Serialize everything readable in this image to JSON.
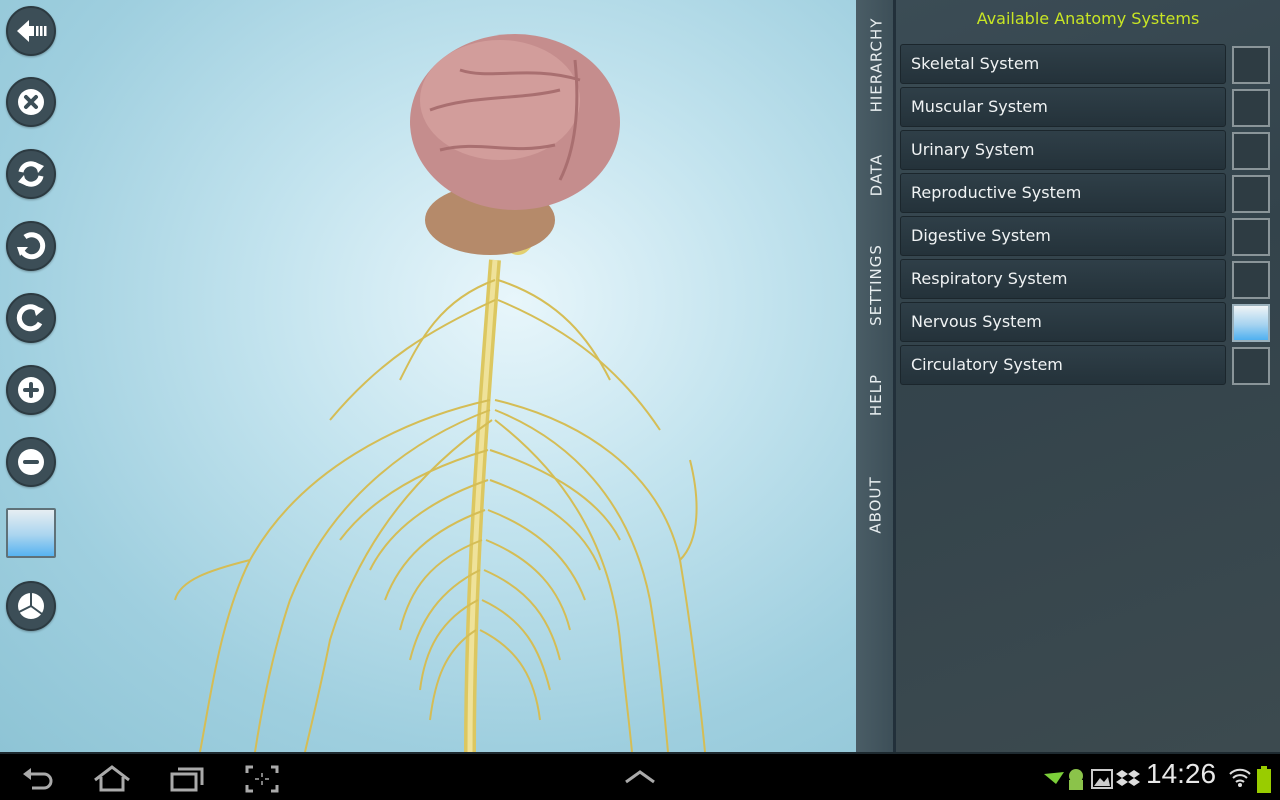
{
  "toolbar": {
    "buttons": [
      {
        "name": "back",
        "icon": "back-arrow-icon"
      },
      {
        "name": "close",
        "icon": "close-icon"
      },
      {
        "name": "reset",
        "icon": "refresh-icon"
      },
      {
        "name": "rotate-left",
        "icon": "rotate-ccw-icon"
      },
      {
        "name": "rotate-right",
        "icon": "rotate-cw-icon"
      },
      {
        "name": "zoom-in",
        "icon": "zoom-in-icon"
      },
      {
        "name": "zoom-out",
        "icon": "zoom-out-icon"
      },
      {
        "name": "color",
        "icon": "color-swatch"
      },
      {
        "name": "pie-view",
        "icon": "pie-chart-icon"
      }
    ]
  },
  "side_tabs": [
    "HIERARCHY",
    "DATA",
    "SETTINGS",
    "HELP",
    "ABOUT"
  ],
  "panel": {
    "title": "Available Anatomy Systems",
    "systems": [
      {
        "label": "Skeletal System",
        "checked": false
      },
      {
        "label": "Muscular System",
        "checked": false
      },
      {
        "label": "Urinary System",
        "checked": false
      },
      {
        "label": "Reproductive System",
        "checked": false
      },
      {
        "label": "Digestive System",
        "checked": false
      },
      {
        "label": "Respiratory System",
        "checked": false
      },
      {
        "label": "Nervous System",
        "checked": true
      },
      {
        "label": "Circulatory System",
        "checked": false
      }
    ]
  },
  "scene": {
    "model": "Nervous system with brain",
    "nerve_color": "#d9c25a",
    "brain_color": "#c98f8f"
  },
  "status_bar": {
    "time": "14:26",
    "battery_color": "#99cc00"
  },
  "colors": {
    "accent": "#c8e524",
    "panel_bg": "#3b4c55",
    "toolbar_btn": "#3c4e57"
  }
}
